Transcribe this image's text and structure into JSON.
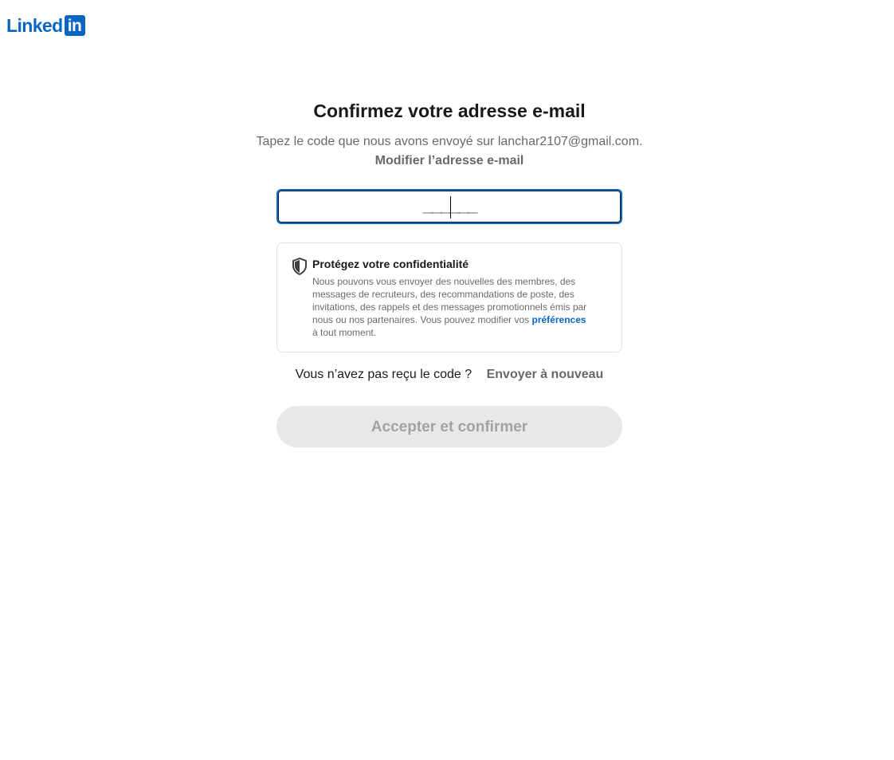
{
  "brand": {
    "wordmark": "Linked",
    "box_text": "in",
    "color": "#0a66c2"
  },
  "verify": {
    "title": "Confirmez votre adresse e-mail",
    "instructions_prefix": "Tapez le code que nous avons envoyé sur ",
    "email": "lanchar2107@gmail.com",
    "instructions_suffix": ".",
    "edit_email_label": "Modifier l’adresse e-mail",
    "code_placeholder": "______",
    "code_value": ""
  },
  "privacy": {
    "icon": "shield-icon",
    "title": "Protégez votre confidentialité",
    "body_text": "Nous pouvons vous envoyer des nouvelles des membres, des messages de recruteurs, des recommandations de poste, des invitations, des rappels et des messages promotionnels émis par nous ou nos partenaires. Vous pouvez modifier vos ",
    "preferences_link": "préférences",
    "body_tail": " à tout moment."
  },
  "resend": {
    "question": "Vous n’avez pas reçu le code ?",
    "link_label": "Envoyer à nouveau"
  },
  "submit": {
    "label": "Accepter et confirmer",
    "enabled": false
  }
}
